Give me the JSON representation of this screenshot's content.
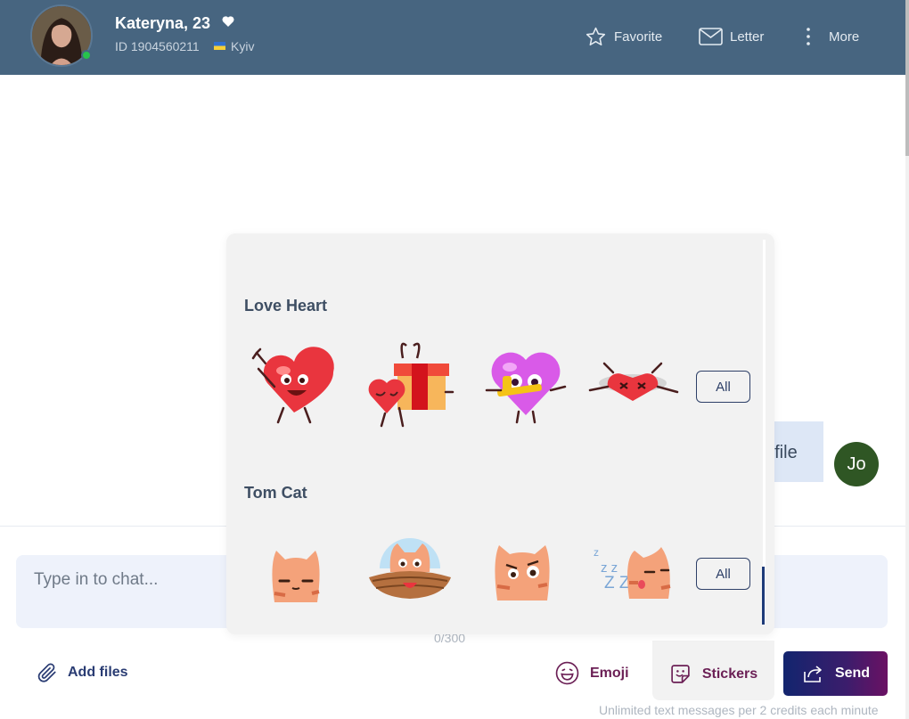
{
  "profile": {
    "name": "Kateryna, 23",
    "id_text": "ID 1904560211",
    "city": "Kyiv",
    "online": true
  },
  "header_actions": {
    "favorite": "Favorite",
    "letter": "Letter",
    "more": "More"
  },
  "chat": {
    "partial_message": "ofile",
    "my_avatar_initials": "Jo",
    "input_placeholder": "Type in to chat...",
    "char_counter": "0/300",
    "footnote": "Unlimited text messages per 2 credits each minute"
  },
  "toolbar": {
    "add_files": "Add files",
    "emoji": "Emoji",
    "stickers": "Stickers",
    "send": "Send"
  },
  "sticker_panel": {
    "sections": [
      {
        "title": "Love Heart",
        "all_label": "All",
        "stickers": [
          "waving-heart",
          "heart-with-gift",
          "heart-with-bandage",
          "heart-eyes-crossed"
        ]
      },
      {
        "title": "Tom Cat",
        "all_label": "All",
        "stickers": [
          "grumpy-cat",
          "cat-in-nest",
          "surprised-cat",
          "sleeping-cat"
        ]
      }
    ]
  },
  "colors": {
    "header_bg": "#476580",
    "online": "#27c24c",
    "input_bg": "#eef2fb",
    "accent_purple": "#6b1f55",
    "send_gradient_start": "#12256e",
    "send_gradient_end": "#6b1163",
    "my_avatar_bg": "#2f5624"
  }
}
